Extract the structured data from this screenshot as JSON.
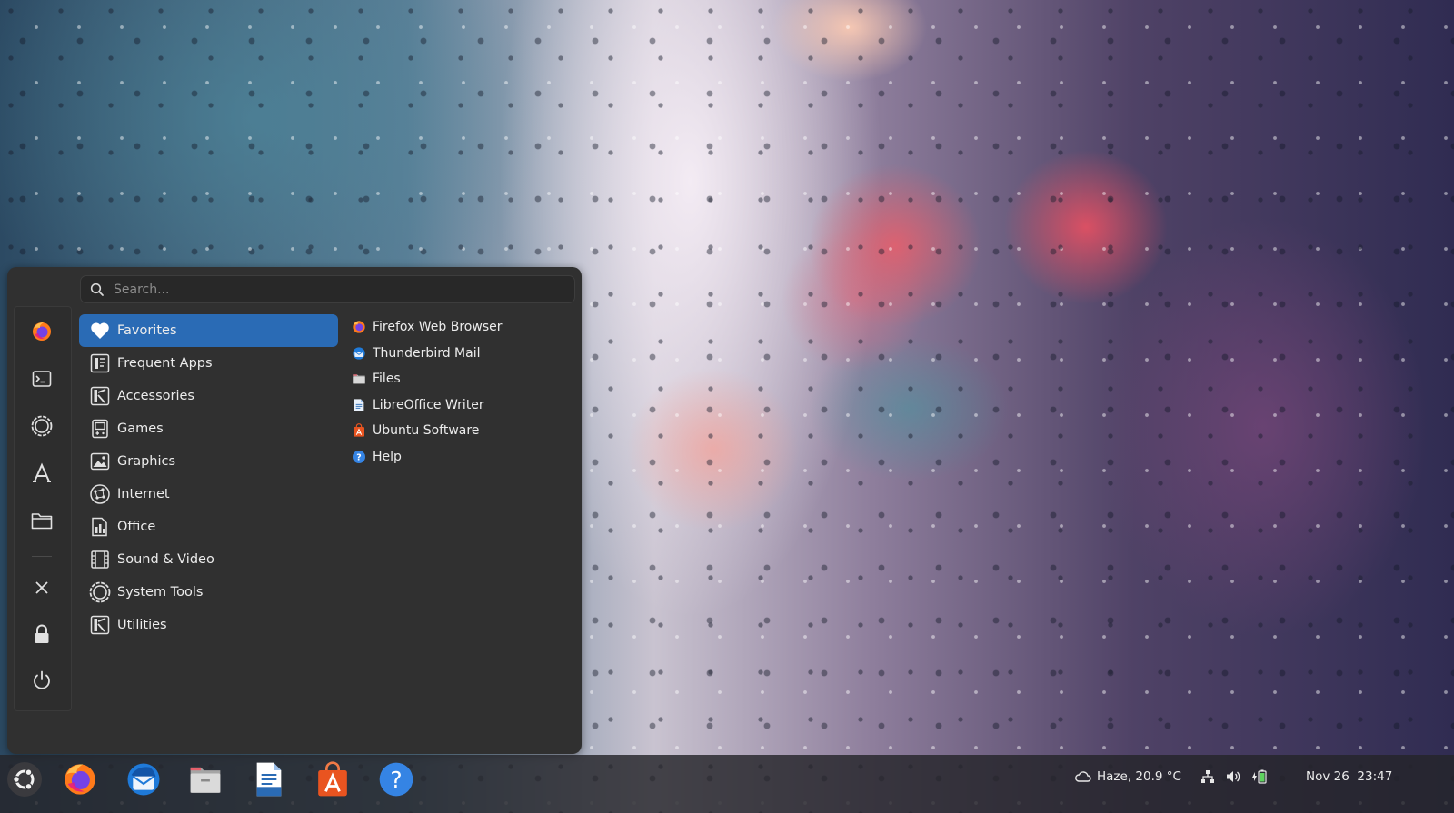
{
  "search": {
    "placeholder": "Search..."
  },
  "sidebar": {
    "items": [
      {
        "name": "firefox",
        "icon": "firefox-icon"
      },
      {
        "name": "terminal",
        "icon": "terminal-icon"
      },
      {
        "name": "settings",
        "icon": "settings-gear-icon"
      },
      {
        "name": "software",
        "icon": "app-store-icon"
      },
      {
        "name": "files",
        "icon": "folder-icon"
      },
      {
        "name": "logout",
        "icon": "close-icon"
      },
      {
        "name": "lock",
        "icon": "lock-icon"
      },
      {
        "name": "power",
        "icon": "power-icon"
      }
    ]
  },
  "categories": [
    {
      "label": "Favorites",
      "icon": "heart-icon",
      "active": true
    },
    {
      "label": "Frequent Apps",
      "icon": "frequent-apps-icon"
    },
    {
      "label": "Accessories",
      "icon": "accessories-icon"
    },
    {
      "label": "Games",
      "icon": "games-icon"
    },
    {
      "label": "Graphics",
      "icon": "graphics-icon"
    },
    {
      "label": "Internet",
      "icon": "internet-icon"
    },
    {
      "label": "Office",
      "icon": "office-icon"
    },
    {
      "label": "Sound & Video",
      "icon": "sound-video-icon"
    },
    {
      "label": "System Tools",
      "icon": "system-tools-icon"
    },
    {
      "label": "Utilities",
      "icon": "utilities-icon"
    }
  ],
  "apps": [
    {
      "label": "Firefox Web Browser",
      "icon": "firefox-icon"
    },
    {
      "label": "Thunderbird Mail",
      "icon": "thunderbird-icon"
    },
    {
      "label": "Files",
      "icon": "files-icon"
    },
    {
      "label": "LibreOffice Writer",
      "icon": "writer-icon"
    },
    {
      "label": "Ubuntu Software",
      "icon": "ubuntu-software-icon"
    },
    {
      "label": "Help",
      "icon": "help-icon"
    }
  ],
  "panel": {
    "weather": "Haze, 20.9 °C",
    "clock": "Nov 26  23:47",
    "dock": [
      "firefox",
      "thunderbird",
      "files",
      "writer",
      "ubuntu-software",
      "help"
    ]
  },
  "colors": {
    "menu_bg": "#303030",
    "accent": "#2a6bb5",
    "panel_bg": "#24242a"
  }
}
